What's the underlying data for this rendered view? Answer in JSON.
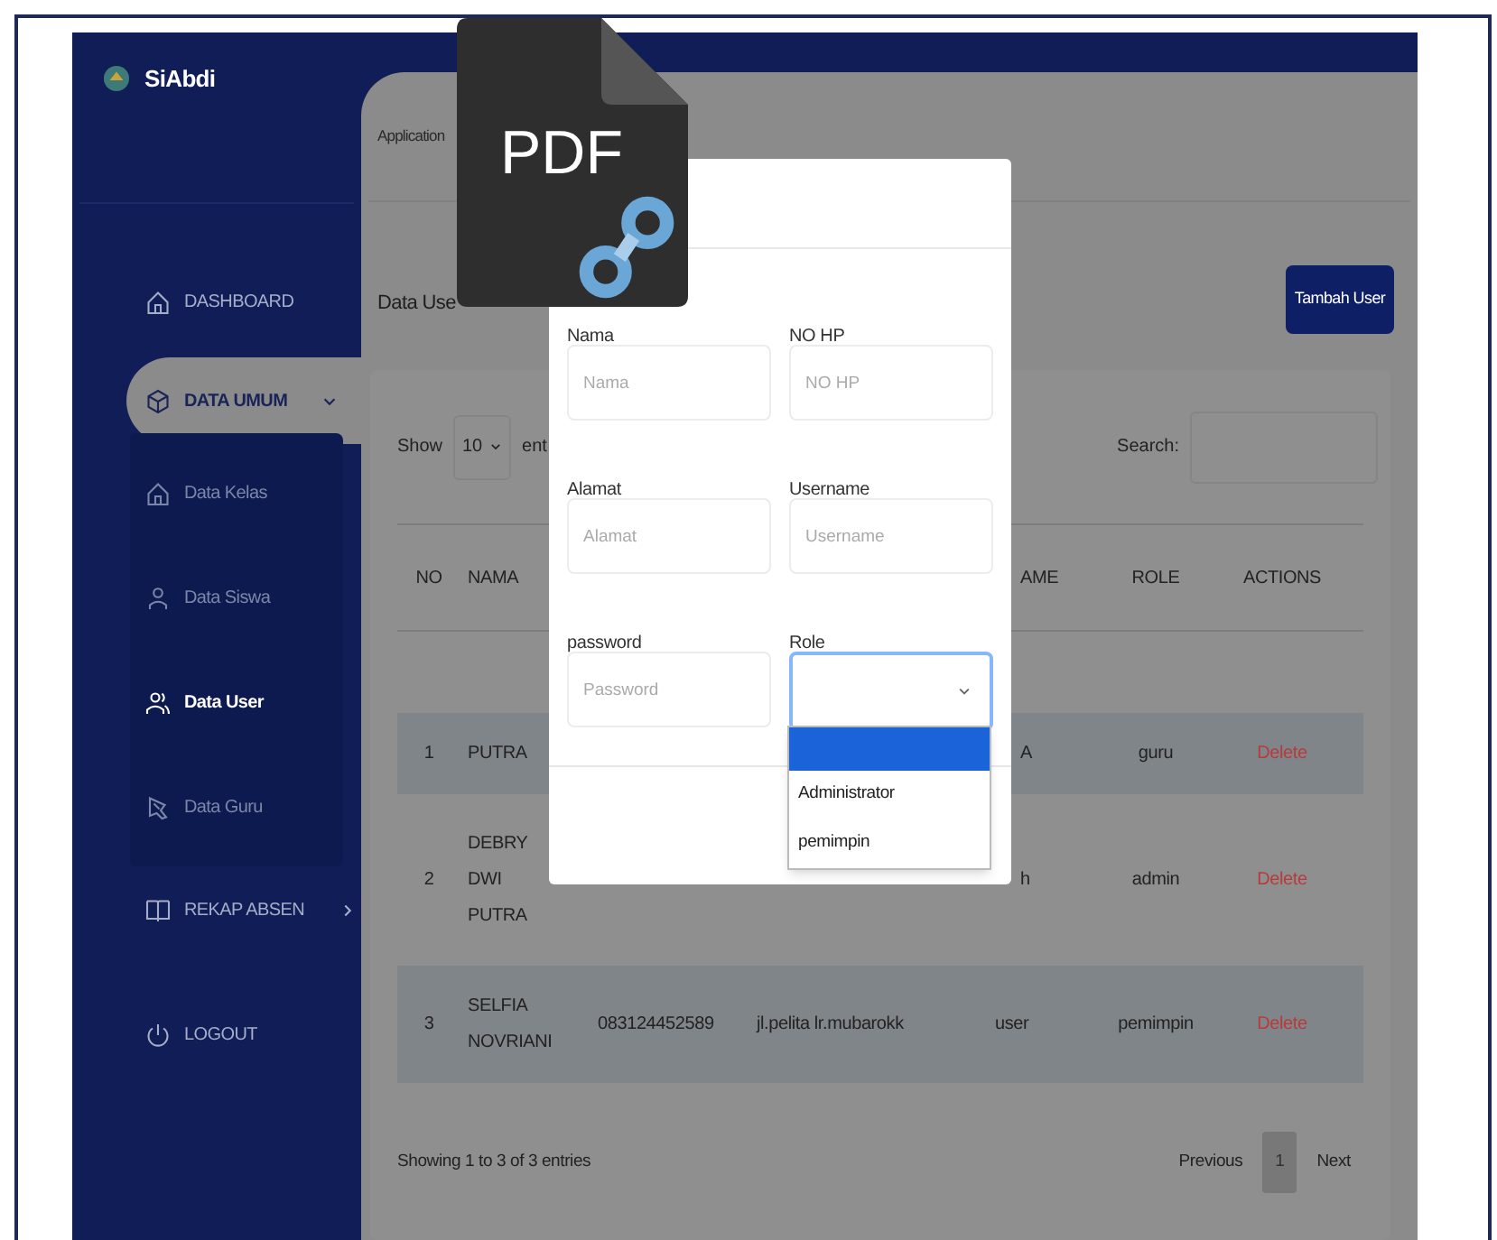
{
  "sidebar": {
    "brand": "SiAbdi",
    "items": [
      {
        "kind": "item",
        "label": "DASHBOARD",
        "selected": false
      },
      {
        "kind": "group",
        "label": "DATA UMUM",
        "selected": true,
        "expanded": true,
        "children": [
          {
            "label": "Data Kelas",
            "selected": false
          },
          {
            "label": "Data Siswa",
            "selected": false
          },
          {
            "label": "Data User",
            "selected": true
          },
          {
            "label": "Data Guru",
            "selected": false
          }
        ]
      },
      {
        "kind": "group",
        "label": "REKAP ABSEN",
        "selected": false,
        "expanded": false
      },
      {
        "kind": "item",
        "label": "LOGOUT",
        "selected": false
      }
    ]
  },
  "breadcrumb": "Application",
  "page_title": "Data Use",
  "add_button": "Tambah User",
  "table_controls": {
    "show_label": "Show",
    "page_size": "10",
    "entries_label": "ent",
    "search_label": "Search:"
  },
  "table": {
    "header": {
      "no": "NO",
      "nama": "NAMA",
      "username_clipped": "AME",
      "role": "ROLE",
      "actions": "ACTIONS"
    },
    "rows": [
      {
        "no": "1",
        "nama": "PUTRA",
        "username_clipped": "A",
        "role": "guru",
        "action": "Delete",
        "shaded": true
      },
      {
        "no": "2",
        "nama": "DEBRY DWI PUTRA",
        "username_clipped": "h",
        "role": "admin",
        "action": "Delete",
        "shaded": false
      },
      {
        "no": "3",
        "nama": "SELFIA NOVRIANI",
        "no_hp": "083124452589",
        "alamat": "jl.pelita lr.mubarokk",
        "username": "user",
        "role": "pemimpin",
        "action": "Delete",
        "shaded": true
      }
    ]
  },
  "footer": {
    "info": "Showing 1 to 3 of 3 entries",
    "pagination": [
      {
        "label": "Previous",
        "selected": false
      },
      {
        "label": "1",
        "selected": true
      },
      {
        "label": "Next",
        "selected": false
      }
    ]
  },
  "modal": {
    "fields": [
      {
        "label": "Nama",
        "placeholder": "Nama",
        "kind": "text"
      },
      {
        "label": "NO HP",
        "placeholder": "NO HP",
        "kind": "text"
      },
      {
        "label": "Alamat",
        "placeholder": "Alamat",
        "kind": "text"
      },
      {
        "label": "Username",
        "placeholder": "Username",
        "kind": "text"
      },
      {
        "label": "password",
        "placeholder": "Password",
        "kind": "text"
      },
      {
        "label": "Role",
        "kind": "select",
        "expanded": true,
        "options": [
          {
            "selected": true
          },
          {
            "label": "Administrator",
            "selected": false
          },
          {
            "label": "pemimpin",
            "selected": false
          }
        ]
      }
    ]
  },
  "pdf_badge": {
    "label": "PDF"
  }
}
